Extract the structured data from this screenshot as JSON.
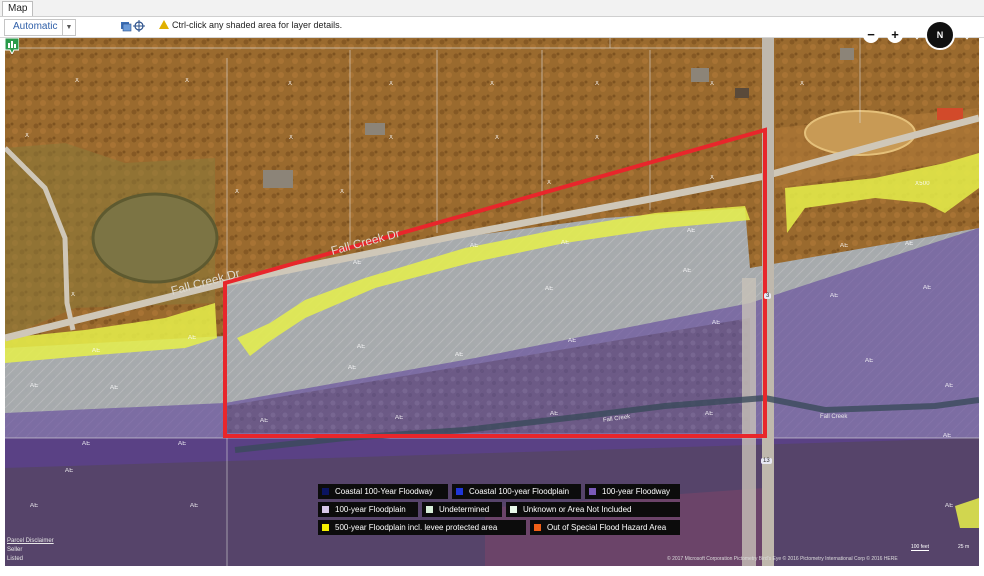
{
  "window": {
    "tab_label": "Map"
  },
  "toolbar": {
    "mode_value": "Automatic",
    "hint_text": "Ctrl-click any shaded area for layer details.",
    "icons": [
      "layers-icon",
      "locate-icon",
      "warning-icon"
    ]
  },
  "map": {
    "road_labels": [
      "Fall Creek Dr",
      "Fall Creek Dr"
    ],
    "creek_labels": [
      "Fall Creek",
      "Fall Creek"
    ],
    "route_shields": [
      "3",
      "13"
    ],
    "zone_labels": {
      "x": [
        "X",
        "X",
        "X",
        "X",
        "X",
        "X",
        "X",
        "X",
        "X",
        "X",
        "X",
        "X",
        "X",
        "X",
        "X",
        "X",
        "X",
        "X"
      ],
      "ae": [
        "AE",
        "AE",
        "AE",
        "AE",
        "AE",
        "AE",
        "AE",
        "AE",
        "AE",
        "AE",
        "AE",
        "AE",
        "AE",
        "AE",
        "AE",
        "AE",
        "AE",
        "AE",
        "AE",
        "AE",
        "AE",
        "AE",
        "AE",
        "AE",
        "AE",
        "AE",
        "AE",
        "AE",
        "AE",
        "AE",
        "AE",
        "AE"
      ],
      "x500": "X500"
    },
    "colors": {
      "parcel_outline": "#e8262b",
      "floodway": "#5a3a9a",
      "floodplain": "#c7c7d8",
      "x500": "#e6f04a"
    }
  },
  "nav": {
    "zoom_out": "−",
    "zoom_in": "+",
    "compass": "N",
    "arrow": "↓"
  },
  "legend": {
    "items": [
      {
        "label": "Coastal 100-Year Floodway",
        "color": "#0a1460"
      },
      {
        "label": "Coastal 100-year Floodplain",
        "color": "#1f36d8"
      },
      {
        "label": "100-year Floodway",
        "color": "#7a5ab8"
      },
      {
        "label": "100-year Floodplain",
        "color": "#d8c8e8"
      },
      {
        "label": "Undetermined",
        "color": "#d8efd8"
      },
      {
        "label": "Unknown or Area Not Included",
        "color": "#e8f8e8"
      },
      {
        "label": "500-year Floodplain incl. levee protected area",
        "color": "#f4f000"
      },
      {
        "label": "Out of Special Flood Hazard Area",
        "color": "#f06018"
      }
    ]
  },
  "attribution": {
    "disclaimer": "Parcel Disclaimer",
    "seller": "Seller",
    "listed": "Listed",
    "copyright": "© 2017 Microsoft Corporation    Pictometry Bird's Eye © 2016 Pictometry International Corp  © 2016 HERE",
    "scale": "100 feet",
    "scale_m": "25 m"
  }
}
